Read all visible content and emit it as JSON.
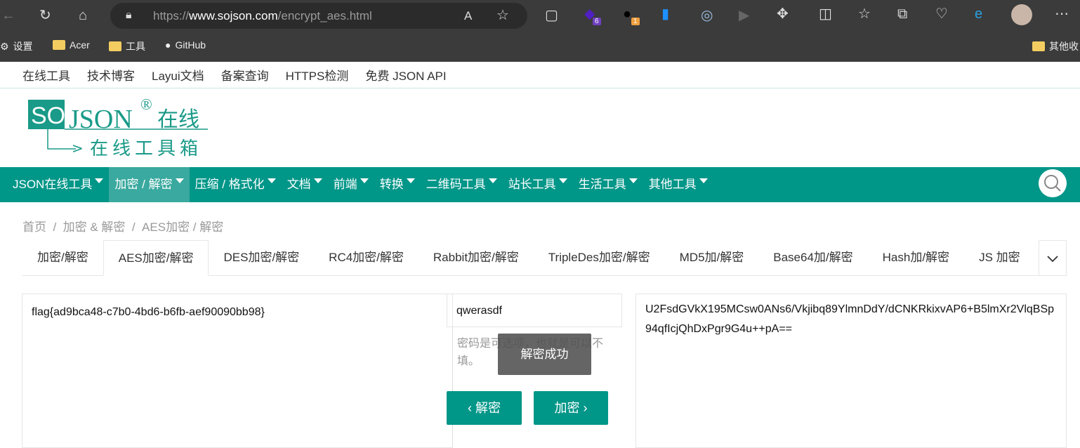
{
  "browser": {
    "url_prefix": "https://",
    "url_domain": "www.sojson.com",
    "url_path": "/encrypt_aes.html",
    "bookmarks": [
      "设置",
      "Acer",
      "工具",
      "GitHub"
    ],
    "other_bookmarks": "其他收",
    "extension_badges": [
      "6",
      "1"
    ]
  },
  "topnav": [
    "在线工具",
    "技术博客",
    "Layui文档",
    "备案查询",
    "HTTPS检测",
    "免费 JSON API"
  ],
  "logo": {
    "text": "SO JSON® 在线 在线工具箱"
  },
  "mainnav": [
    "JSON在线工具",
    "加密 / 解密",
    "压缩 / 格式化",
    "文档",
    "前端",
    "转换",
    "二维码工具",
    "站长工具",
    "生活工具",
    "其他工具"
  ],
  "breadcrumb": [
    "首页",
    "加密 & 解密",
    "AES加密 / 解密"
  ],
  "tabs": [
    "加密/解密",
    "AES加密/解密",
    "DES加密/解密",
    "RC4加密/解密",
    "Rabbit加密/解密",
    "TripleDes加密/解密",
    "MD5加/解密",
    "Base64加/解密",
    "Hash加/解密",
    "JS 加密"
  ],
  "form": {
    "plaintext": "flag{ad9bca48-c7b0-4bd6-b6fb-aef90090bb98}",
    "password": "qwerasdf",
    "password_hint": "密码是可选项，也就是可以不填。",
    "ciphertext": "U2FsdGVkX195MCsw0ANs6/Vkjibq89YlmnDdY/dCNKRkixvAP6+B5lmXr2VlqBSp94qfIcjQhDxPgr9G4u++pA==",
    "decrypt_label": "解密",
    "encrypt_label": "加密",
    "toast": "解密成功"
  },
  "colors": {
    "brand": "#009688"
  }
}
